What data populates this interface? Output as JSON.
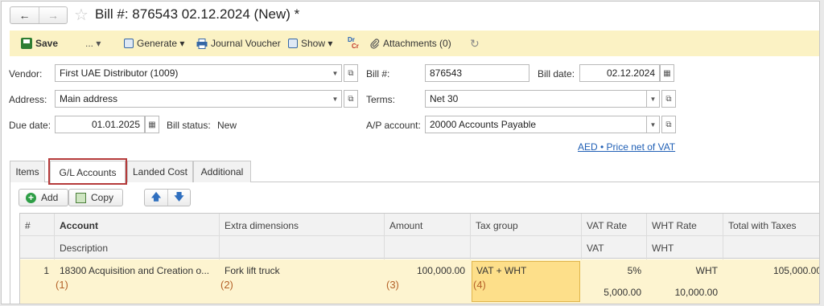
{
  "window": {
    "title": "Bill #: 876543 02.12.2024 (New) *",
    "back_icon": "←",
    "forward_icon": "→",
    "star_icon": "☆"
  },
  "toolbar": {
    "save": "Save",
    "more": "... ▾",
    "generate": "Generate ▾",
    "journal_voucher": "Journal Voucher",
    "show": "Show ▾",
    "drcr_top": "Dr",
    "drcr_bottom": "Cr",
    "attachments": "Attachments (0)",
    "refresh_icon": "↻"
  },
  "form": {
    "vendor_label": "Vendor:",
    "vendor_value": "First UAE Distributor (1009)",
    "address_label": "Address:",
    "address_value": "Main address",
    "due_date_label": "Due date:",
    "due_date_value": "01.01.2025",
    "bill_status_label": "Bill status:",
    "bill_status_value": "New",
    "bill_no_label": "Bill #:",
    "bill_no_value": "876543",
    "bill_date_label": "Bill date:",
    "bill_date_value": "02.12.2024",
    "terms_label": "Terms:",
    "terms_value": "Net 30",
    "ap_account_label": "A/P account:",
    "ap_account_value": "20000 Accounts Payable",
    "currency_link": "AED • Price net of VAT"
  },
  "tabs": [
    "Items",
    "G/L Accounts",
    "Landed Cost",
    "Additional"
  ],
  "table_toolbar": {
    "add": "Add",
    "copy": "Copy",
    "up_icon": "🡅",
    "down_icon": "🡇"
  },
  "table": {
    "headers_row1": [
      "#",
      "Account",
      "Extra dimensions",
      "Amount",
      "Tax group",
      "VAT Rate",
      "WHT Rate",
      "Total with Taxes"
    ],
    "headers_row2": [
      "Description",
      "VAT",
      "WHT"
    ],
    "rows": [
      {
        "num": "1",
        "account": "18300 Acquisition and Creation o...",
        "extra_dimensions": "Fork lift truck",
        "amount": "100,000.00",
        "tax_group": "VAT + WHT",
        "vat_rate": "5%",
        "wht_rate": "WHT",
        "total_with_taxes": "105,000.00",
        "vat": "5,000.00",
        "wht": "10,000.00"
      }
    ],
    "markers": [
      "(1)",
      "(2)",
      "(3)",
      "(4)"
    ]
  },
  "colors": {
    "toolbar_bg": "#fbf2c4",
    "row_bg": "#fdf4d0",
    "tax_cell_bg": "#fddf8a",
    "highlight_border": "#b53a3a",
    "link": "#1f5fb5"
  }
}
